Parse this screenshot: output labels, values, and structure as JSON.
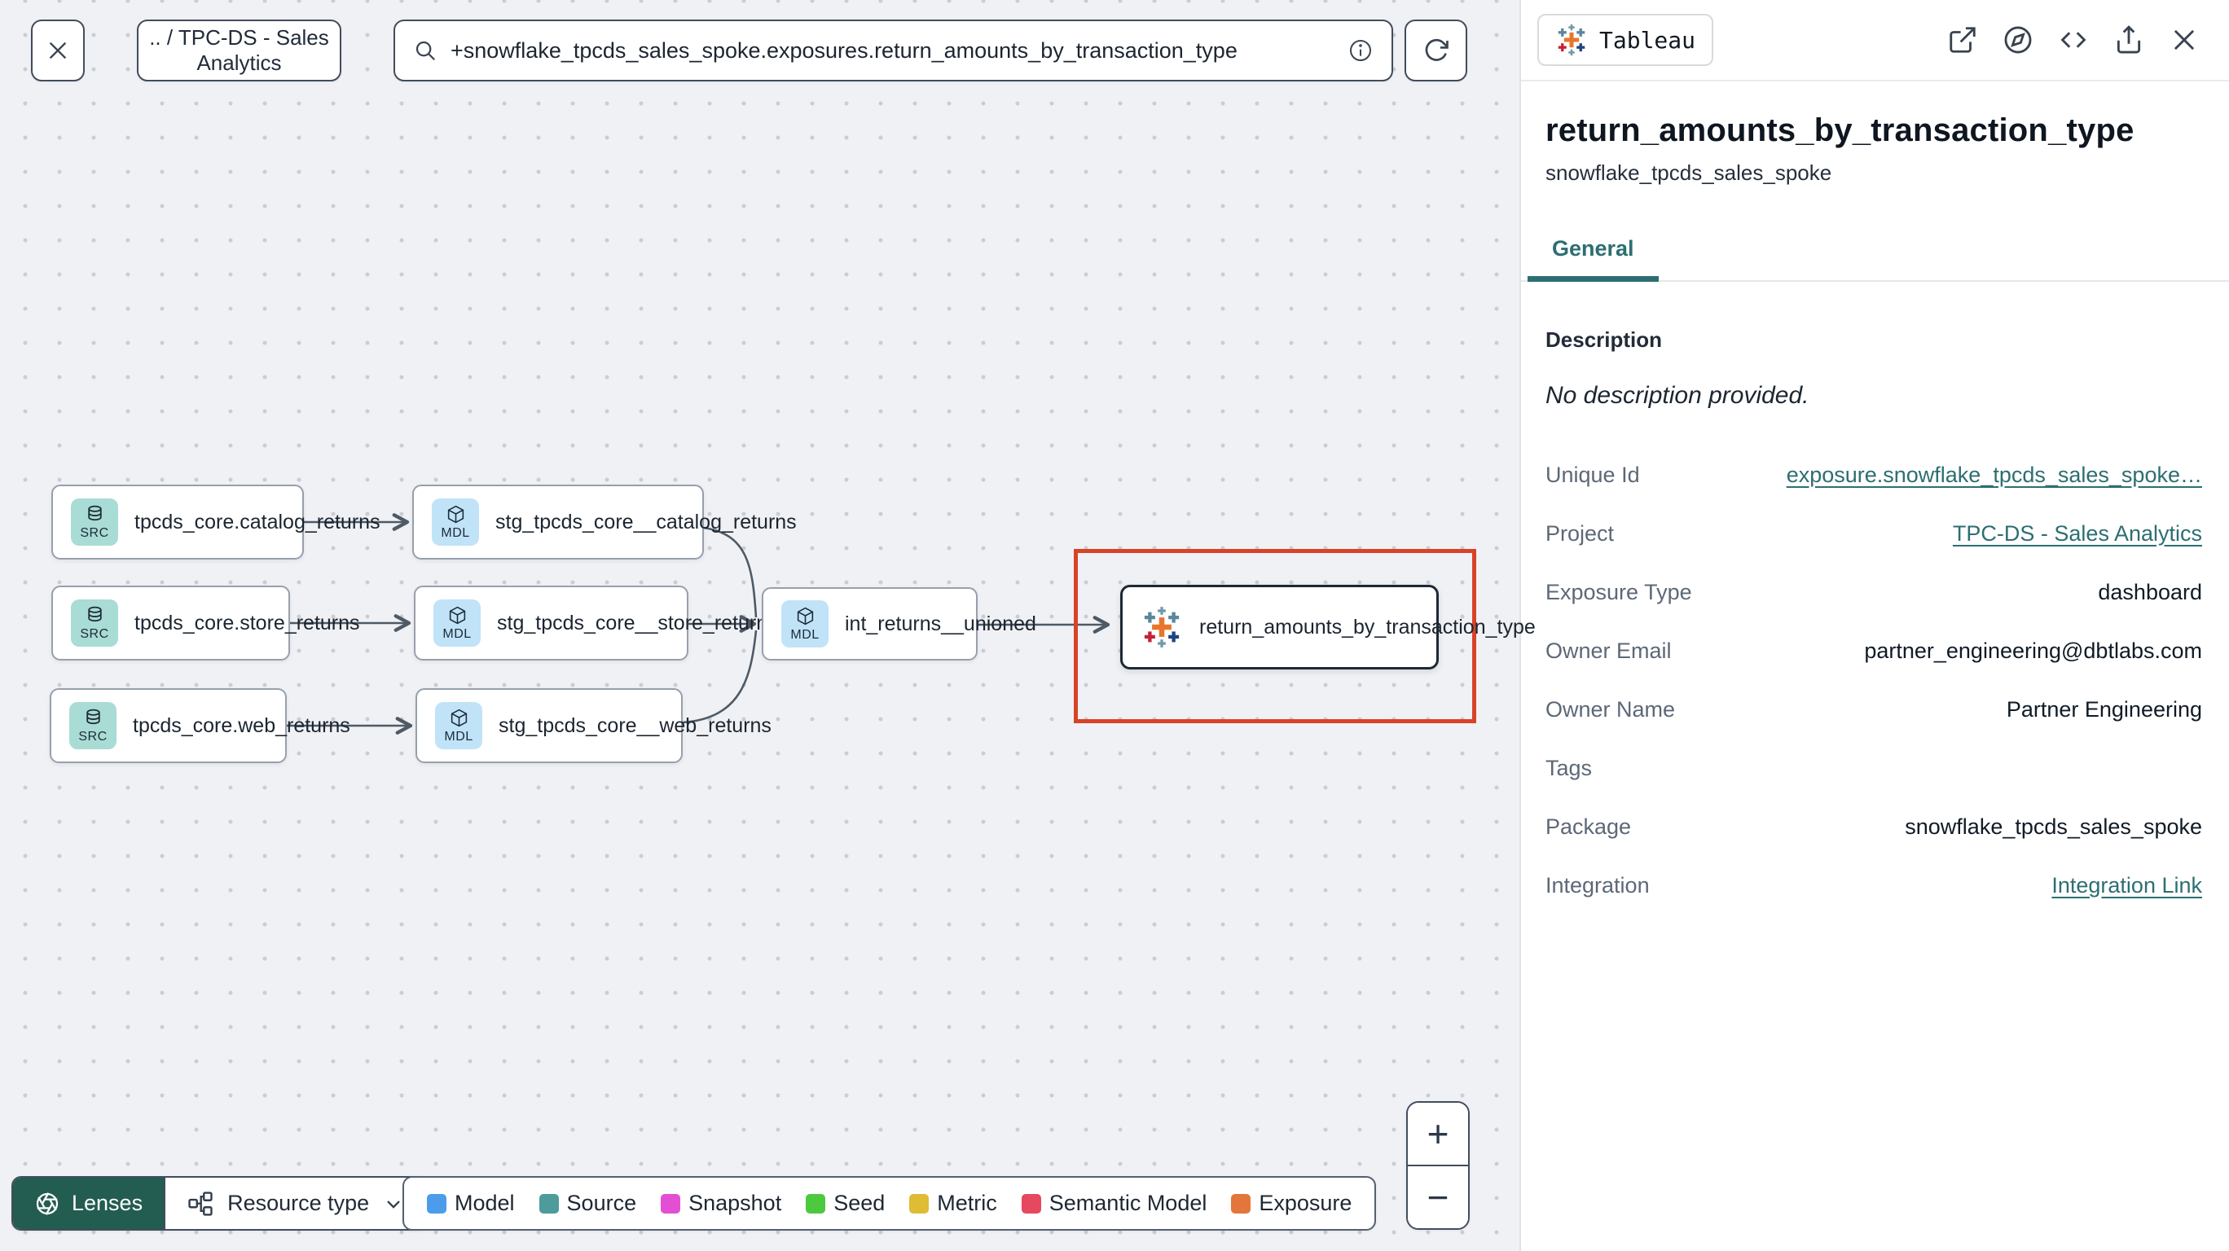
{
  "toolbar": {
    "breadcrumb": ".. / TPC-DS - Sales Analytics",
    "search_value": "+snowflake_tpcds_sales_spoke.exposures.return_amounts_by_transaction_type"
  },
  "graph": {
    "nodes": [
      {
        "badge": "SRC",
        "label": "tpcds_core.catalog_returns"
      },
      {
        "badge": "SRC",
        "label": "tpcds_core.store_returns"
      },
      {
        "badge": "SRC",
        "label": "tpcds_core.web_returns"
      },
      {
        "badge": "MDL",
        "label": "stg_tpcds_core__catalog_returns"
      },
      {
        "badge": "MDL",
        "label": "stg_tpcds_core__store_returns"
      },
      {
        "badge": "MDL",
        "label": "stg_tpcds_core__web_returns"
      },
      {
        "badge": "MDL",
        "label": "int_returns__unioned"
      },
      {
        "badge": "tableau",
        "label": "return_amounts_by_transaction_type"
      }
    ]
  },
  "legend": {
    "lenses_label": "Lenses",
    "resource_type_label": "Resource type",
    "items": [
      {
        "label": "Model",
        "color": "#4d9cec"
      },
      {
        "label": "Source",
        "color": "#4d9b9b"
      },
      {
        "label": "Snapshot",
        "color": "#e34fd3"
      },
      {
        "label": "Seed",
        "color": "#4cc93f"
      },
      {
        "label": "Metric",
        "color": "#dfbc33"
      },
      {
        "label": "Semantic Model",
        "color": "#e5485f"
      },
      {
        "label": "Exposure",
        "color": "#e2763b"
      }
    ]
  },
  "zoom_controls": {
    "zoom_in": "+",
    "zoom_out": "−"
  },
  "panel": {
    "source_badge": "Tableau",
    "title": "return_amounts_by_transaction_type",
    "subtitle": "snowflake_tpcds_sales_spoke",
    "tab": "General",
    "description_label": "Description",
    "description_value": "No description provided.",
    "fields": [
      {
        "label": "Unique Id",
        "value": "exposure.snowflake_tpcds_sales_spoke…"
      },
      {
        "label": "Project",
        "value": "TPC-DS - Sales Analytics"
      },
      {
        "label": "Exposure Type",
        "value": "dashboard"
      },
      {
        "label": "Owner Email",
        "value": "partner_engineering@dbtlabs.com"
      },
      {
        "label": "Owner Name",
        "value": "Partner Engineering"
      },
      {
        "label": "Tags",
        "value": ""
      },
      {
        "label": "Package",
        "value": "snowflake_tpcds_sales_spoke"
      },
      {
        "label": "Integration",
        "value": "Integration Link"
      }
    ]
  },
  "colors": {
    "accent_teal": "#2d6e72",
    "lenses_bg": "#235c50",
    "selection_red": "#d84328",
    "source_badge_bg": "#a9dcd4",
    "model_badge_bg": "#c0e3f8"
  }
}
